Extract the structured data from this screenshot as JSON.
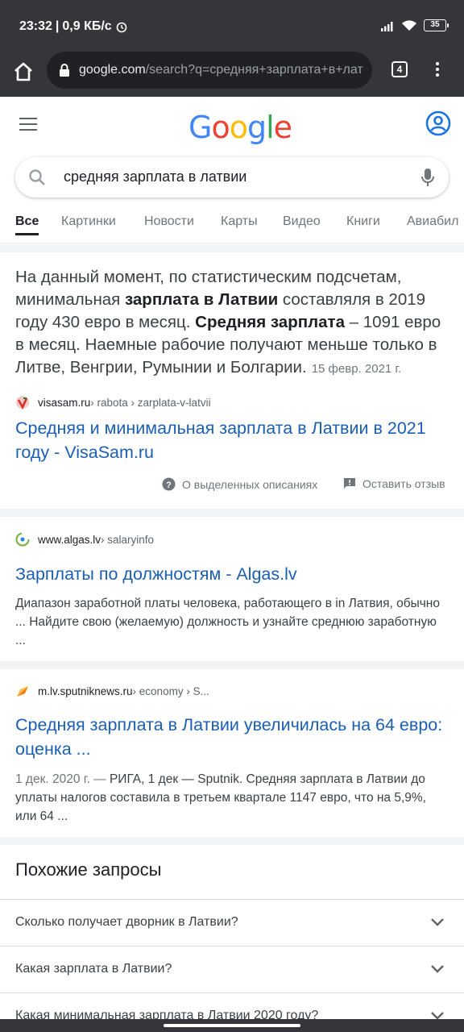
{
  "status": {
    "time": "23:32",
    "speed": "0,9 КБ/с",
    "battery": "35"
  },
  "browser": {
    "url_host": "google.com",
    "url_path": "/search?q=средняя+зарплата+в+лат",
    "tab_count": "4"
  },
  "google": {
    "logo_letters": [
      "G",
      "o",
      "o",
      "g",
      "l",
      "e"
    ],
    "logo_colors": [
      "#4285F4",
      "#EA4335",
      "#FBBC05",
      "#4285F4",
      "#34A853",
      "#EA4335"
    ],
    "query": "средняя зарплата в латвии",
    "tabs": [
      "Все",
      "Картинки",
      "Новости",
      "Карты",
      "Видео",
      "Книги",
      "Авиабил"
    ]
  },
  "snippet": {
    "text_1": "На данный момент, по статистическим подсчетам, минимальная ",
    "bold_1": "зарплата в Латвии",
    "text_2": " составляля в 2019 году 430 евро в месяц. ",
    "bold_2": "Средняя зарплата",
    "text_3": " – 1091 евро в месяц. Наемные рабочие получают меньше только в Литве, Венгрии, Румынии и Болгарии.",
    "date": "15 февр. 2021 г.",
    "source_domain": "visasam.ru",
    "source_path": " › rabota › zarplata-v-latvii",
    "title": "Средняя и минимальная зарплата в Латвии в 2021 году - VisaSam.ru",
    "about_label": "О выделенных описаниях",
    "feedback_label": "Оставить отзыв"
  },
  "results": [
    {
      "domain": "www.algas.lv",
      "path": " › salaryinfo",
      "title": "Зарплаты по должностям - Algas.lv",
      "date": "",
      "desc": "Диапазон заработной платы человека, работающего в in Латвия, обычно ... Найдите свою (желаемую) должность и узнайте среднюю заработную ..."
    },
    {
      "domain": "m.lv.sputniknews.ru",
      "path": " › economy › S...",
      "title": "Средняя зарплата в Латвии увеличилась на 64 евро: оценка ...",
      "date": "1 дек. 2020 г. — ",
      "desc": "РИГА, 1 дек — Sputnik. Средняя зарплата в Латвии до уплаты налогов составила в третьем квартале 1147 евро, что на 5,9%, или 64 ..."
    }
  ],
  "related": {
    "title": "Похожие запросы",
    "items": [
      "Сколько получает дворник в Латвии?",
      "Какая зарплата в Латвии?",
      "Какая минимальная зарплата в Латвии 2020 году?"
    ]
  },
  "icons": {
    "home": "home-icon",
    "lock": "lock-icon",
    "tabs": "tab-switcher-icon",
    "menu": "more-vert-icon",
    "hamburger": "hamburger-menu-icon",
    "account": "account-circle-icon",
    "search": "search-icon",
    "mic": "microphone-icon",
    "help": "help-circle-icon",
    "feedback": "feedback-icon",
    "chevron": "chevron-down-icon"
  }
}
